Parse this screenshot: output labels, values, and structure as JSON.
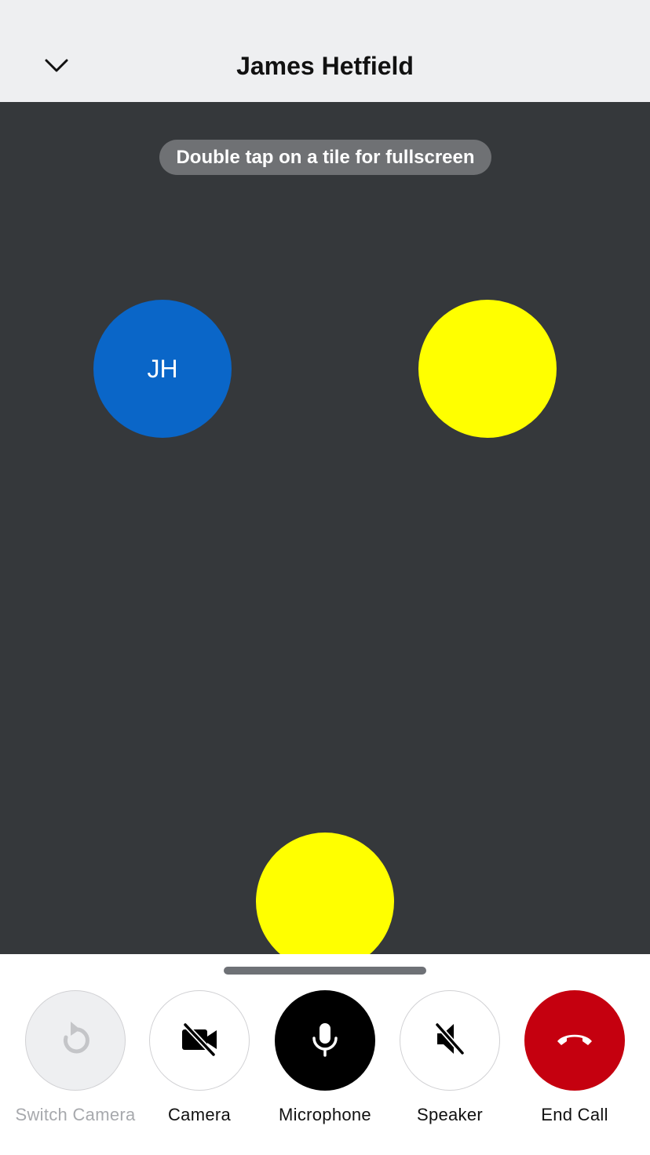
{
  "header": {
    "title": "James Hetfield",
    "collapse_icon": "chevron-down-icon"
  },
  "stage": {
    "hint": "Double tap on a tile for fullscreen",
    "tiles": [
      {
        "initials": "JH",
        "color": "#0a66c8"
      },
      {
        "initials": "",
        "color": "#ffff00"
      },
      {
        "initials": "",
        "color": "#ffff00"
      }
    ]
  },
  "controls": {
    "switch_camera": {
      "label": "Switch Camera",
      "icon": "switch-camera-icon",
      "state": "disabled"
    },
    "camera": {
      "label": "Camera",
      "icon": "video-off-icon",
      "state": "off"
    },
    "microphone": {
      "label": "Microphone",
      "icon": "microphone-icon",
      "state": "on"
    },
    "speaker": {
      "label": "Speaker",
      "icon": "speaker-off-icon",
      "state": "off"
    },
    "end_call": {
      "label": "End Call",
      "icon": "hang-up-icon",
      "color": "#c5000f"
    }
  },
  "colors": {
    "stage_background": "#35383b",
    "header_background": "#eeeff1",
    "accent_blue": "#0a66c8",
    "end_call_red": "#c5000f"
  }
}
